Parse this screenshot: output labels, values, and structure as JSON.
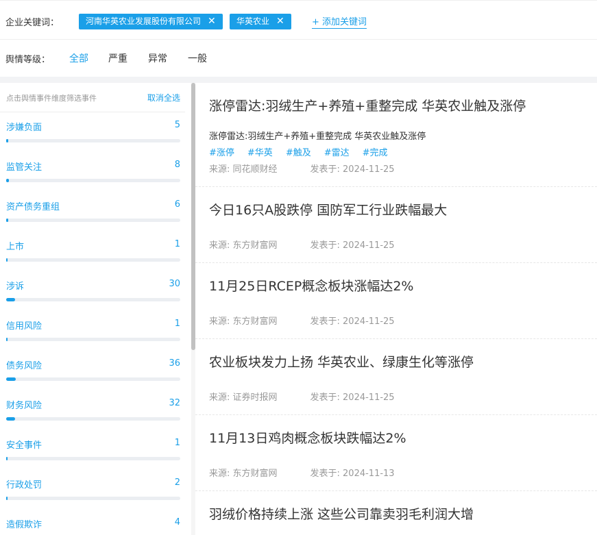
{
  "keywords": {
    "label": "企业关键词：",
    "tags": [
      {
        "text": "河南华英农业发展股份有限公司",
        "close": "✕"
      },
      {
        "text": "华英农业",
        "close": "✕"
      }
    ],
    "add_label": "+ 添加关键词"
  },
  "level": {
    "label": "舆情等级：",
    "options": [
      "全部",
      "严重",
      "异常",
      "一般"
    ],
    "selected": "全部"
  },
  "sidebar": {
    "hint": "点击舆情事件维度筛选事件",
    "clear_label": "取消全选",
    "items": [
      {
        "name": "涉嫌负面",
        "count": "5",
        "fraction": 0.01
      },
      {
        "name": "监管关注",
        "count": "8",
        "fraction": 0.015
      },
      {
        "name": "资产债务重组",
        "count": "6",
        "fraction": 0.01
      },
      {
        "name": "上市",
        "count": "1",
        "fraction": 0.004
      },
      {
        "name": "涉诉",
        "count": "30",
        "fraction": 0.05
      },
      {
        "name": "信用风险",
        "count": "1",
        "fraction": 0.004
      },
      {
        "name": "债务风险",
        "count": "36",
        "fraction": 0.055
      },
      {
        "name": "财务风险",
        "count": "32",
        "fraction": 0.05
      },
      {
        "name": "安全事件",
        "count": "1",
        "fraction": 0.004
      },
      {
        "name": "行政处罚",
        "count": "2",
        "fraction": 0.006
      },
      {
        "name": "造假欺诈",
        "count": "4",
        "fraction": 0.008
      }
    ]
  },
  "news": [
    {
      "title": "涨停雷达:羽绒生产+养殖+重整完成 华英农业触及涨停",
      "summary": "涨停雷达:羽绒生产+养殖+重整完成 华英农业触及涨停",
      "tags": [
        "#涨停",
        "#华英",
        "#触及",
        "#雷达",
        "#完成"
      ],
      "source": "来源: 同花顺财经",
      "date": "发表于:  2024-11-25"
    },
    {
      "title": "今日16只A股跌停 国防军工行业跌幅最大",
      "source": "来源: 东方财富网",
      "date": "发表于:  2024-11-25"
    },
    {
      "title": "11月25日RCEP概念板块涨幅达2%",
      "source": "来源: 东方财富网",
      "date": "发表于:  2024-11-25"
    },
    {
      "title": "农业板块发力上扬 华英农业、绿康生化等涨停",
      "source": "来源: 证券时报网",
      "date": "发表于:  2024-11-25"
    },
    {
      "title": "11月13日鸡肉概念板块跌幅达2%",
      "source": "来源: 东方财富网",
      "date": "发表于:  2024-11-13"
    },
    {
      "title": "羽绒价格持续上涨 这些公司靠卖羽毛利润大增"
    }
  ],
  "colors": {
    "accent": "#1a9fe8",
    "track": "#ebeef2",
    "muted": "#999999"
  }
}
